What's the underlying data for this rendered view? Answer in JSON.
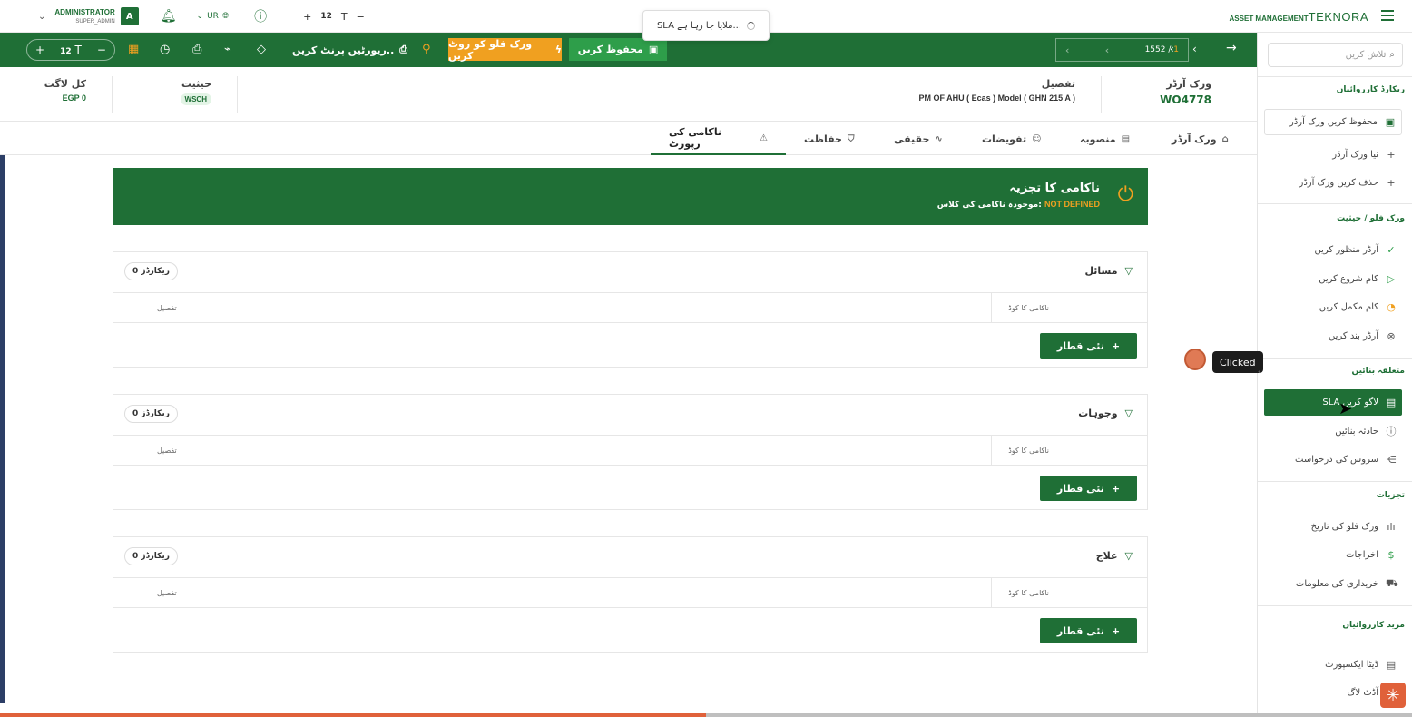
{
  "header": {
    "user_name": "ADMINISTRATOR",
    "user_role": "SUPER_ADMIN",
    "avatar_letter": "A",
    "language": "UR",
    "font_size": "12",
    "brand_sub": "ASSET MANAGEMENT",
    "brand_name": "TEKNORA"
  },
  "toast": {
    "text": "SLA ملایا جا رہا ہے..."
  },
  "toolbar": {
    "font_size": "12",
    "print_routine_label": "ریورٹیں پرنٹ کریں..",
    "route_workflow_label": "ورک فلو کو روٹ کریں",
    "save_label": "محفوظ کریں",
    "pager_current": "1",
    "pager_separator": "/",
    "pager_total": "1552"
  },
  "info": {
    "work_order_label": "ورک آرڈر",
    "work_order_value": "WO4778",
    "detail_label": "تفصیل",
    "detail_value": "PM OF AHU ( Ecas ) Model ( GHN 215 A )",
    "status_label": "حیثیت",
    "status_value": "WSCH",
    "total_cost_label": "کل لاگت",
    "total_cost_value": "EGP 0"
  },
  "tabs": [
    {
      "label": "ورک آرڈر"
    },
    {
      "label": "منصوبہ"
    },
    {
      "label": "تفویضات"
    },
    {
      "label": "حقیقی"
    },
    {
      "label": "حفاظت"
    },
    {
      "label": "ناکامی کی رپورٹ"
    }
  ],
  "banner": {
    "title": "ناکامی کا تجزیہ",
    "subtitle_prefix": "موجودہ ناکامی کی کلاس:",
    "subtitle_value": "NOT DEFINED"
  },
  "cards": [
    {
      "title": "مسائل",
      "records": "0 ریکارڈز",
      "col_code": "ناکامی کا کوڈ",
      "col_detail": "تفصیل",
      "add_label": "نئی قطار"
    },
    {
      "title": "وجوہات",
      "records": "0 ریکارڈز",
      "col_code": "ناکامی کا کوڈ",
      "col_detail": "تفصیل",
      "add_label": "نئی قطار"
    },
    {
      "title": "علاج",
      "records": "0 ریکارڈز",
      "col_code": "ناکامی کا کوڈ",
      "col_detail": "تفصیل",
      "add_label": "نئی قطار"
    }
  ],
  "sidebar": {
    "search_placeholder": "تلاش کریں",
    "sections": [
      "ریکارڈ کارروائیاں",
      "ورک فلو / حیثیت",
      "متعلقہ بنائیں",
      "تجزیات",
      "مزید کارروائیاں"
    ],
    "items": [
      {
        "label": "محفوظ کریں ورک آرڈر"
      },
      {
        "label": "نیا ورک آرڈر"
      },
      {
        "label": "حذف کریں ورک آرڈر"
      },
      {
        "label": "آرڈر منظور کریں"
      },
      {
        "label": "کام شروع کریں"
      },
      {
        "label": "کام مکمل کریں"
      },
      {
        "label": "آرڈر بند کریں"
      },
      {
        "label": "SLA لاگو کریں"
      },
      {
        "label": "حادثہ بنائیں"
      },
      {
        "label": "سروس کی درخواست"
      },
      {
        "label": "ورک فلو کی تاریخ"
      },
      {
        "label": "اخراجات"
      },
      {
        "label": "خریداری کی معلومات"
      },
      {
        "label": "ڈیٹا ایکسپورٹ"
      },
      {
        "label": "آڈٹ لاگ"
      }
    ]
  },
  "click_indicator": {
    "label": "Clicked"
  },
  "progress": {
    "fraction": 0.5
  },
  "colors": {
    "primary": "#1f6f36",
    "accent": "#f0a020",
    "save_green": "#2e9e4a",
    "progress": "#e0613a"
  }
}
